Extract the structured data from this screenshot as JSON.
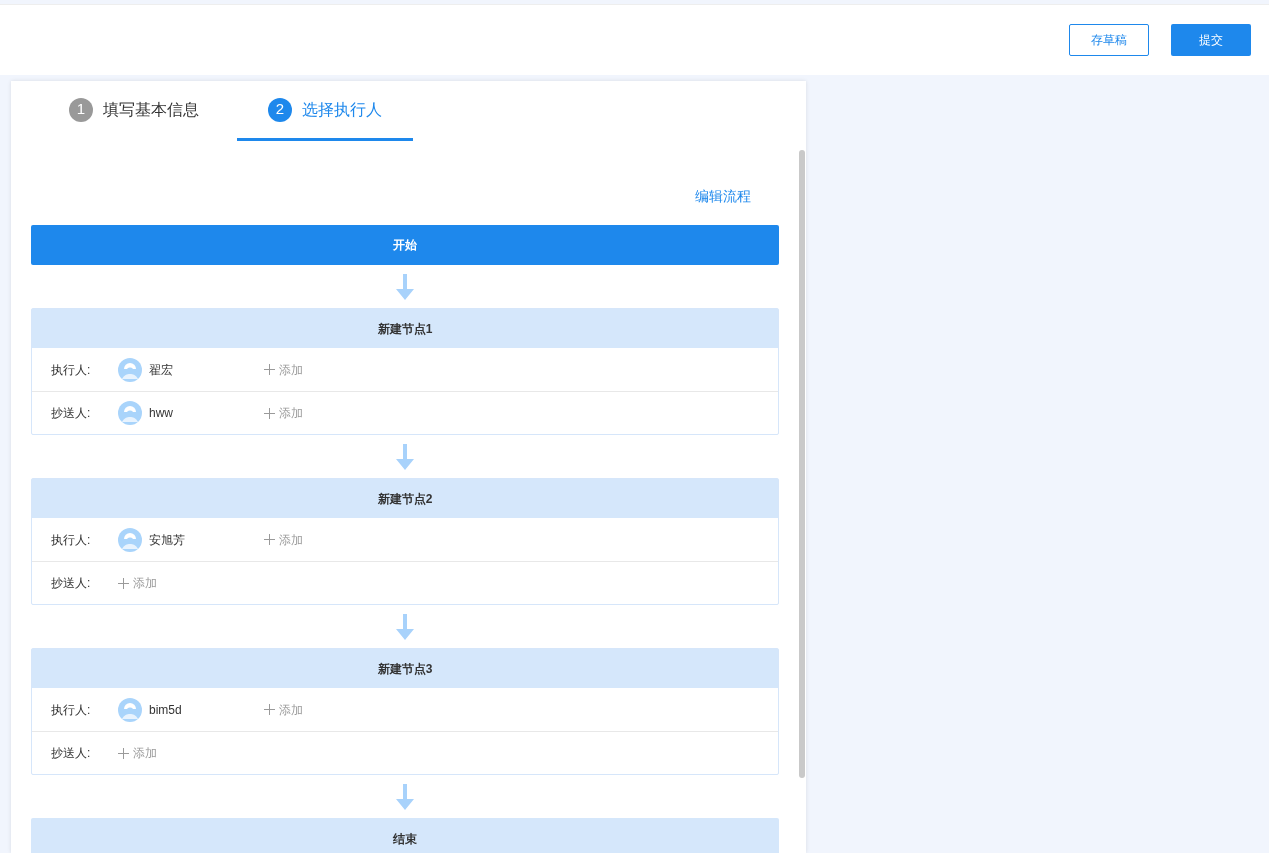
{
  "header": {
    "buttons": [
      {
        "label": "存草稿",
        "kind": "outline"
      },
      {
        "label": "提交",
        "kind": "primary"
      }
    ]
  },
  "steps": [
    {
      "number": "1",
      "label": "填写基本信息",
      "selected": false
    },
    {
      "number": "2",
      "label": "选择执行人",
      "selected": true
    }
  ],
  "edit_link": "编辑流程",
  "start": "开始",
  "nodes": [
    {
      "title": "新建节点1",
      "rows": [
        {
          "label": "执行人:",
          "people": [
            "翟宏"
          ],
          "add": "添加"
        },
        {
          "label": "抄送人:",
          "people": [
            "hww"
          ],
          "add": "添加"
        }
      ]
    },
    {
      "title": "新建节点2",
      "rows": [
        {
          "label": "执行人:",
          "people": [
            "安旭芳"
          ],
          "add": "添加"
        },
        {
          "label": "抄送人:",
          "people": [],
          "add": "添加"
        }
      ]
    },
    {
      "title": "新建节点3",
      "rows": [
        {
          "label": "执行人:",
          "people": [
            "bim5d"
          ],
          "add": "添加"
        },
        {
          "label": "抄送人:",
          "people": [],
          "add": "添加"
        }
      ]
    }
  ],
  "end": "结束"
}
